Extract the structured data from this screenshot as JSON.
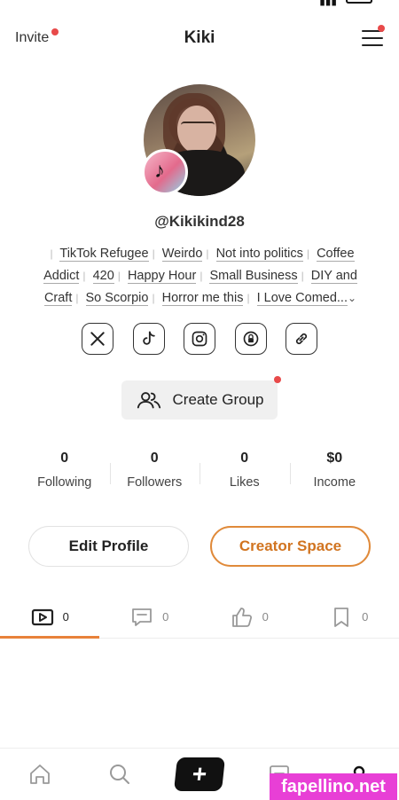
{
  "header": {
    "invite_label": "Invite",
    "title": "Kiki"
  },
  "profile": {
    "handle": "@Kikikind28"
  },
  "tags": [
    "TikTok Refugee",
    "Weirdo",
    "Not into politics",
    "Coffee Addict",
    "420",
    "Happy Hour",
    "Small Business",
    "DIY and Craft",
    "So Scorpio",
    "Horror me this",
    "I Love Comed..."
  ],
  "socials": [
    "x-icon",
    "tiktok-icon",
    "instagram-icon",
    "lock-icon",
    "link-icon"
  ],
  "create_group_label": "Create Group",
  "stats": [
    {
      "value": "0",
      "label": "Following"
    },
    {
      "value": "0",
      "label": "Followers"
    },
    {
      "value": "0",
      "label": "Likes"
    },
    {
      "value": "$0",
      "label": "Income"
    }
  ],
  "buttons": {
    "edit_profile": "Edit Profile",
    "creator_space": "Creator Space"
  },
  "tabs": [
    {
      "icon": "video-icon",
      "count": "0"
    },
    {
      "icon": "comment-icon",
      "count": "0"
    },
    {
      "icon": "thumbs-up-icon",
      "count": "0"
    },
    {
      "icon": "bookmark-icon",
      "count": "0"
    }
  ],
  "bottom_nav": {
    "plus_label": "+"
  },
  "watermark": "fapellino.net",
  "colors": {
    "accent": "#e8823a",
    "notification_dot": "#e84a4a",
    "watermark_bg": "#e83fd6"
  }
}
